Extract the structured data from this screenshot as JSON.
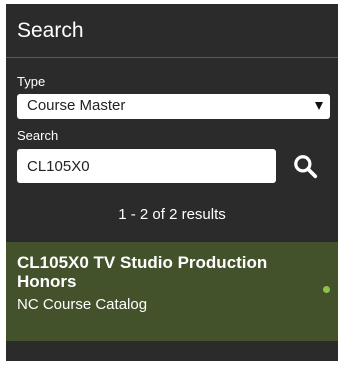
{
  "header": {
    "title": "Search"
  },
  "filters": {
    "type_label": "Type",
    "type_value": "Course Master",
    "search_label": "Search",
    "search_value": "CL105X0"
  },
  "results": {
    "summary": "1 - 2 of 2 results",
    "items": [
      {
        "title": "CL105X0 TV Studio Production Honors",
        "source": "NC Course Catalog",
        "status_color": "#8bc34a"
      }
    ]
  },
  "icons": {
    "search": "search-icon",
    "dropdown": "caret-down-icon",
    "status": "status-dot"
  },
  "colors": {
    "panel_bg": "#2b2b2b",
    "result_bg": "#43522b",
    "status_green": "#8bc34a"
  }
}
